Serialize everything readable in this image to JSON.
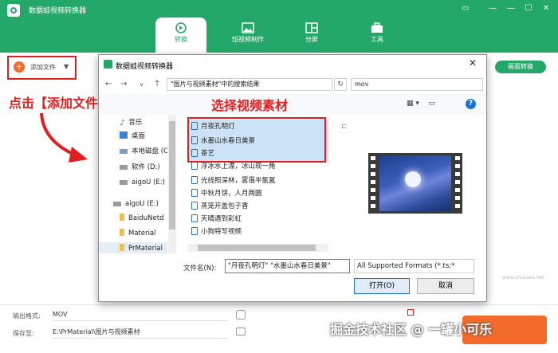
{
  "app": {
    "title": "数据蛙视频转换器",
    "window_controls": [
      "▭",
      "—",
      "☐",
      "✕"
    ]
  },
  "nav_tabs": [
    {
      "label": "转换",
      "icon": "convert-icon",
      "active": true
    },
    {
      "label": "短视频制作",
      "icon": "image-icon",
      "active": false
    },
    {
      "label": "分屏",
      "icon": "split-screen-icon",
      "active": false
    },
    {
      "label": "工具",
      "icon": "toolbox-icon",
      "active": false
    }
  ],
  "toolbar": {
    "add_file_label": "添加文件",
    "add_file_caret": "▼",
    "convert_all_label": "画面转换"
  },
  "annotations": {
    "click_add": "点击【添加文件】",
    "select_material": "选择视频素材"
  },
  "bottom": {
    "output_format_label": "输出格式:",
    "output_format_value": "MOV",
    "save_to_label": "保存至:",
    "save_to_value": "E:\\PrMaterial\\图片与视频素材"
  },
  "watermark": "掘金技术社区 @ 一罐小可乐",
  "dialog": {
    "title": "数据蛙视频转换器",
    "close": "✕",
    "nav_buttons": [
      "←",
      "→",
      "↑"
    ],
    "breadcrumb": "\"图片与视频素材\"中的搜索结果",
    "refresh": "↻",
    "search_value": "mov",
    "nav_pane": [
      {
        "label": "音乐",
        "icon": "music-icon"
      },
      {
        "label": "桌面",
        "icon": "desktop-icon"
      },
      {
        "label": "本地磁盘 (C",
        "icon": "drive-icon"
      },
      {
        "label": "软件 (D:)",
        "icon": "drive-icon"
      },
      {
        "label": "aigoU (E:)",
        "icon": "usb-drive-icon"
      },
      {
        "label": "aigoU (E:)",
        "icon": "usb-drive-icon"
      },
      {
        "label": "BaiduNetd",
        "icon": "folder-icon"
      },
      {
        "label": "Material",
        "icon": "folder-icon"
      },
      {
        "label": "PrMaterial",
        "icon": "folder-icon"
      }
    ],
    "files": [
      {
        "name": "月夜孔明灯",
        "selected": true
      },
      {
        "name": "水墨山水春日美景",
        "selected": true
      },
      {
        "name": "茶艺",
        "selected": true
      },
      {
        "name": "浮冰水上漂，冰山现一角",
        "selected": false
      },
      {
        "name": "光线照深林，雾霭半氤氲",
        "selected": false
      },
      {
        "name": "中秋月饼，人月两圆",
        "selected": false
      },
      {
        "name": "蒸笼开盖包子香",
        "selected": false
      },
      {
        "name": "天晴遇到彩虹",
        "selected": false
      },
      {
        "name": "小狗特写视频",
        "selected": false
      }
    ],
    "filename_label": "文件名(N):",
    "filename_value": "\"月夜孔明灯\" \"水墨山水春日美景\"",
    "filetype_value": "All Supported Formats (*.ts;*",
    "open_label": "打开(O)",
    "cancel_label": "取消",
    "site_mark": "www.shujuwa.net"
  }
}
